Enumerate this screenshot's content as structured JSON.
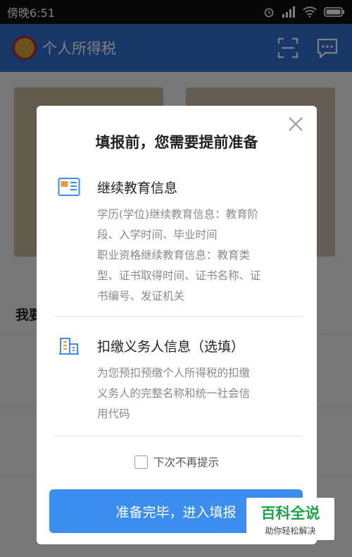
{
  "status_bar": {
    "time": "傍晚6:51"
  },
  "app_bar": {
    "title": "个人所得税"
  },
  "background": {
    "section_title": "我要"
  },
  "dialog": {
    "title": "填报前，您需要提前准备",
    "items": [
      {
        "label": "继续教育信息",
        "description_lines": [
          "学历(学位)继续教育信息：教育阶",
          "段、入学时间、毕业时间",
          "职业资格继续教育信息：教育类",
          "型、证书取得时间、证书名称、证",
          "书编号、发证机关"
        ]
      },
      {
        "label": "扣缴义务人信息（选填）",
        "description_lines": [
          "为您预扣预缴个人所得税的扣缴",
          "义务人的完整名称和统一社会信",
          "用代码"
        ]
      }
    ],
    "checkbox_label": "下次不再提示",
    "primary_button": "准备完毕，进入填报"
  },
  "watermark": {
    "big": "百科全说",
    "small": "助你轻松解决"
  },
  "colors": {
    "app_bar": "#2f6fd1",
    "primary": "#3b8ef0"
  }
}
